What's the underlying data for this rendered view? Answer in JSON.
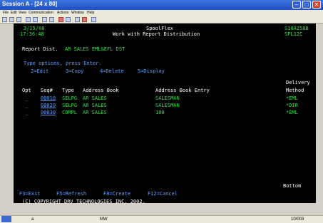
{
  "window": {
    "title": "Session A - [24 x 80]"
  },
  "menu": [
    "File",
    "Edit",
    "View",
    "Communication",
    "Actions",
    "Window",
    "Help"
  ],
  "screen": {
    "date": "3/15/08",
    "time": "17:36:48",
    "app": "SpoolFlex",
    "heading": "Work with Report Distribution",
    "system_id": "S10A258B",
    "program_id": "SFL12C",
    "report_dist_label": "Report Dist.",
    "report_dist_value": "AR SALES EML&EFL DST",
    "instructions": "Type options, press Enter.",
    "options": [
      "2=Edit",
      "3=Copy",
      "4=Delete",
      "5=Display"
    ],
    "col_delivery": "Delivery",
    "headers": [
      "Opt",
      "Seq#",
      "Type",
      "Address Book",
      "Address Book Entry",
      "Method"
    ],
    "rows": [
      {
        "opt": "_",
        "seq": "00010",
        "type": "SELPG",
        "book": "AR SALES",
        "entry": "SALESMAN",
        "method": "*EML"
      },
      {
        "opt": "_",
        "seq": "00020",
        "type": "SELPG",
        "book": "AR SALES",
        "entry": "SALESMAN",
        "method": "*DIR"
      },
      {
        "opt": "_",
        "seq": "00030",
        "type": "COMPL",
        "book": "AR SALES",
        "entry": "100",
        "method": "*EML"
      }
    ],
    "position": "Bottom",
    "fkeys": [
      "F3=Exit",
      "F5=Refresh",
      "F8=Create",
      "F12=Cancel"
    ],
    "copyright": "(C) COPYRIGHT DRV TECHNOLOGIES INC. 2002."
  },
  "status": {
    "session": "a",
    "mode": "MW",
    "cursor": "10/003"
  }
}
